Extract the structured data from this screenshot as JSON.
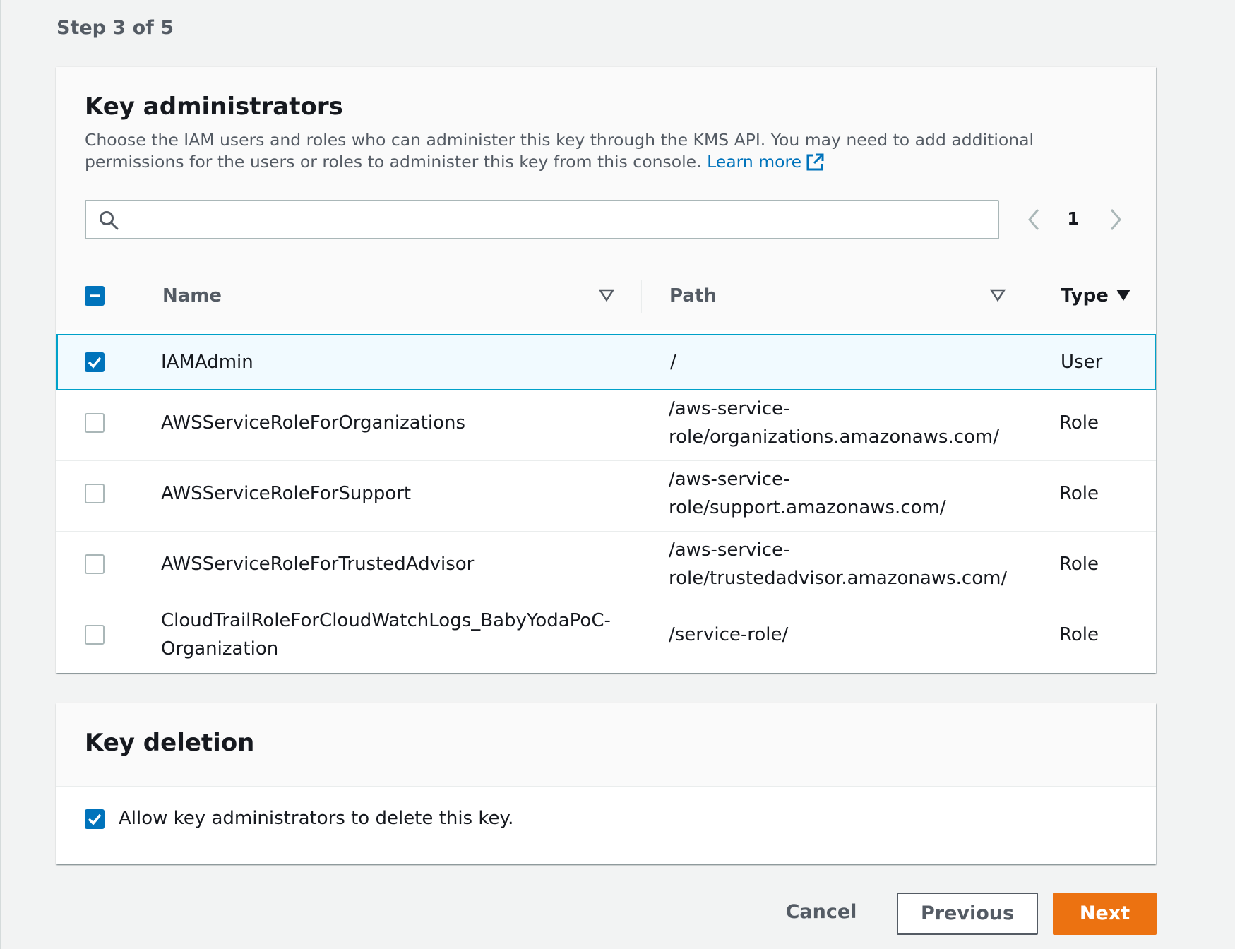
{
  "step_label": "Step 3 of 5",
  "admins": {
    "title": "Key administrators",
    "description": "Choose the IAM users and roles who can administer this key through the KMS API. You may need to add additional permissions for the users or roles to administer this key from this console.",
    "learn_more": "Learn more",
    "search_placeholder": "",
    "page_number": "1",
    "columns": {
      "name": "Name",
      "path": "Path",
      "type": "Type"
    },
    "rows": [
      {
        "name": "IAMAdmin",
        "path": "/",
        "type": "User",
        "selected": true
      },
      {
        "name": "AWSServiceRoleForOrganizations",
        "path_line1": "/aws-service-",
        "path_line2": "role/organizations.amazonaws.com/",
        "type": "Role",
        "selected": false
      },
      {
        "name": "AWSServiceRoleForSupport",
        "path_line1": "/aws-service-",
        "path_line2": "role/support.amazonaws.com/",
        "type": "Role",
        "selected": false
      },
      {
        "name": "AWSServiceRoleForTrustedAdvisor",
        "path_line1": "/aws-service-",
        "path_line2": "role/trustedadvisor.amazonaws.com/",
        "type": "Role",
        "selected": false
      },
      {
        "name_line1": "CloudTrailRoleForCloudWatchLogs_BabyYodaPoC-",
        "name_line2": "Organization",
        "path": "/service-role/",
        "type": "Role",
        "selected": false
      }
    ]
  },
  "deletion": {
    "title": "Key deletion",
    "allow_label": "Allow key administrators to delete this key.",
    "allow_checked": true
  },
  "footer": {
    "cancel": "Cancel",
    "previous": "Previous",
    "next": "Next"
  },
  "colors": {
    "accent": "#0073bb",
    "primary_button": "#ec7211",
    "selected_row_border": "#00a1c9"
  }
}
